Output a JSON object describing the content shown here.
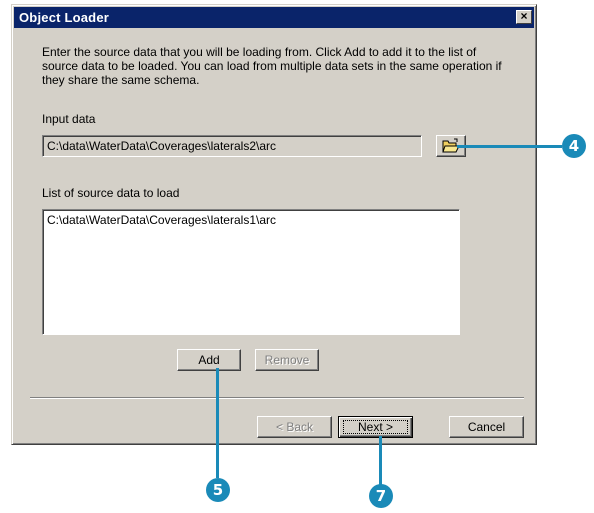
{
  "dialog": {
    "title": "Object Loader",
    "close_label": "×",
    "intro": "Enter the source data that you will be loading from. Click Add to add it to the list of source data to be loaded. You can load from multiple data sets in the same operation if they share the same schema.",
    "input_label": "Input data",
    "input_value": "C:\\data\\WaterData\\Coverages\\laterals2\\arc",
    "list_label": "List of source data to load",
    "list_items": [
      "C:\\data\\WaterData\\Coverages\\laterals1\\arc"
    ],
    "add_label": "Add",
    "remove_label": "Remove",
    "back_label": "< Back",
    "next_label": "Next >",
    "cancel_label": "Cancel"
  },
  "callouts": {
    "browse": "4",
    "add": "5",
    "next": "7"
  },
  "colors": {
    "titlebar": "#0a246a",
    "callout": "#1a8ab8",
    "dialog_face": "#d4d0c8"
  },
  "icons": {
    "browse": "open-folder-icon",
    "close": "close-icon"
  }
}
